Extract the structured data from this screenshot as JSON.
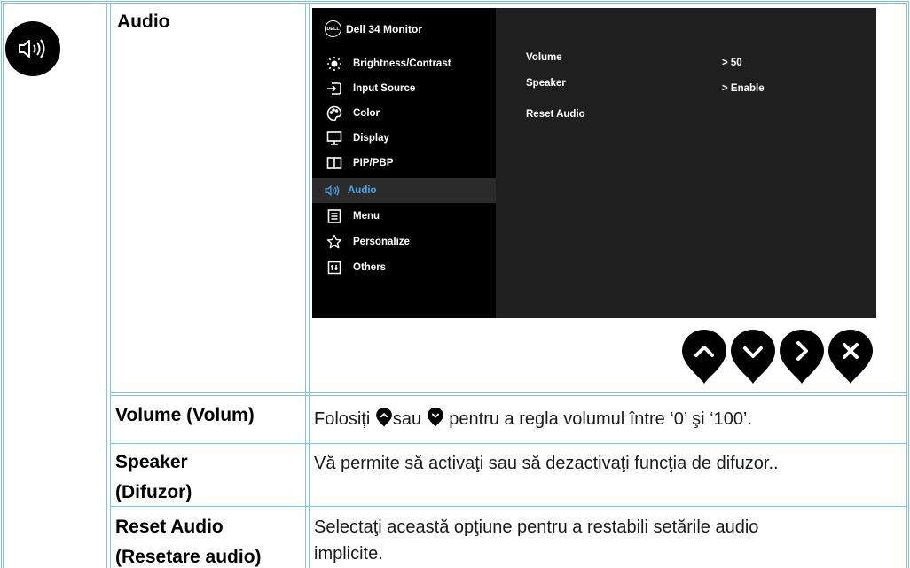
{
  "heading": "Audio",
  "osd": {
    "brand": "Dell 34 Monitor",
    "logo_text": "DELL",
    "menu": [
      {
        "label": "Brightness/Contrast",
        "icon": "brightness-icon"
      },
      {
        "label": "Input Source",
        "icon": "input-source-icon"
      },
      {
        "label": "Color",
        "icon": "color-palette-icon"
      },
      {
        "label": "Display",
        "icon": "display-icon"
      },
      {
        "label": "PIP/PBP",
        "icon": "pip-icon"
      },
      {
        "label": "Audio",
        "icon": "speaker-icon",
        "active": true
      },
      {
        "label": "Menu",
        "icon": "menu-icon"
      },
      {
        "label": "Personalize",
        "icon": "star-icon"
      },
      {
        "label": "Others",
        "icon": "others-icon"
      }
    ],
    "settings": [
      {
        "label": "Volume",
        "value": "> 50"
      },
      {
        "label": "Speaker",
        "value": "> Enable"
      },
      {
        "label": "Reset Audio",
        "value": ""
      }
    ],
    "active_color": "#4aa7e6"
  },
  "nav_buttons": [
    "up-arrow-icon",
    "down-arrow-icon",
    "right-arrow-icon",
    "close-icon"
  ],
  "rows": [
    {
      "term": "Volume (Volum)",
      "desc_before": "Folosiți ",
      "desc_mid": "sau ",
      "desc_after": " pentru a regla volumul între ‘0’ şi ‘100’."
    },
    {
      "term_line1": "Speaker",
      "term_line2": "(Difuzor)",
      "desc": "Vă permite să activaţi sau să dezactivaţi funcţia de difuzor.."
    },
    {
      "term_line1": "Reset Audio",
      "term_line2": "(Resetare audio)",
      "desc_line1": "Selectaţi această opţiune pentru a restabili setările audio",
      "desc_line2": "implicite."
    }
  ]
}
